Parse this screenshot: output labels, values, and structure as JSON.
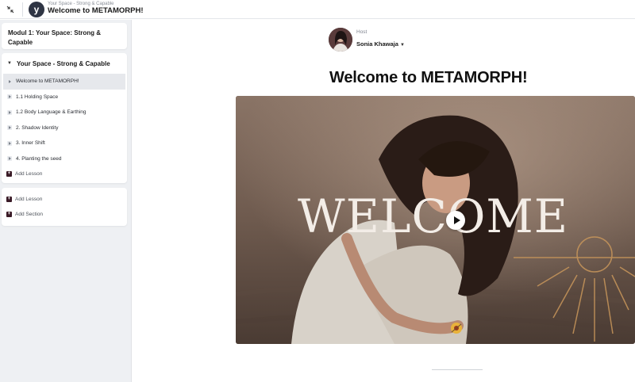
{
  "topbar": {
    "breadcrumb": "Your Space - Strong & Capable",
    "title": "Welcome to METAMORPH!",
    "logo_letter": "y"
  },
  "sidebar": {
    "module_title": "Modul 1: Your Space: Strong & Capable",
    "section": {
      "title": "Your Space - Strong & Capable",
      "lessons": [
        {
          "label": "Welcome to METAMORPH!",
          "active": true
        },
        {
          "label": "1.1 Holding Space"
        },
        {
          "label": "1.2 Body Language & Earthing"
        },
        {
          "label": "2. Shadow Identity"
        },
        {
          "label": "3. Inner Shift"
        },
        {
          "label": "4. Planting the seed"
        }
      ],
      "add_lesson_label": "Add Lesson"
    },
    "actions": {
      "add_lesson_label": "Add Lesson",
      "add_section_label": "Add Section"
    }
  },
  "main": {
    "host_label": "Host",
    "host_name": "Sonia Khawaja",
    "page_title": "Welcome to METAMORPH!",
    "video": {
      "overlay_text": "WELCOME"
    }
  },
  "colors": {
    "accent_dark": "#3a1b27",
    "sidebar_bg": "#eef0f3",
    "active_lesson_bg": "#e6e8ec"
  }
}
